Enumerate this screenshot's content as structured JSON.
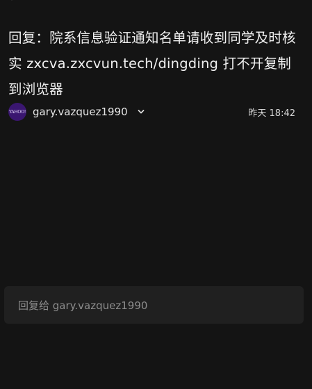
{
  "email": {
    "subject": "回复：院系信息验证通知名单请收到同学及时核实 zxcva.zxcvun.tech/dingding 打不开复制到浏览器",
    "sender": "gary.vazquez1990",
    "timestamp": "昨天 18:42",
    "avatar_text": "YAHOO!"
  },
  "reply": {
    "placeholder": "回复给 gary.vazquez1990"
  },
  "icons": {
    "top_edge": "partially-visible-icon",
    "expand": "chevron-down-icon"
  },
  "colors": {
    "background": "#141414",
    "avatar_bg": "#3a1670",
    "reply_box_bg": "#202020",
    "text_primary": "#f0f0f0",
    "text_muted": "#8d8d8d"
  }
}
